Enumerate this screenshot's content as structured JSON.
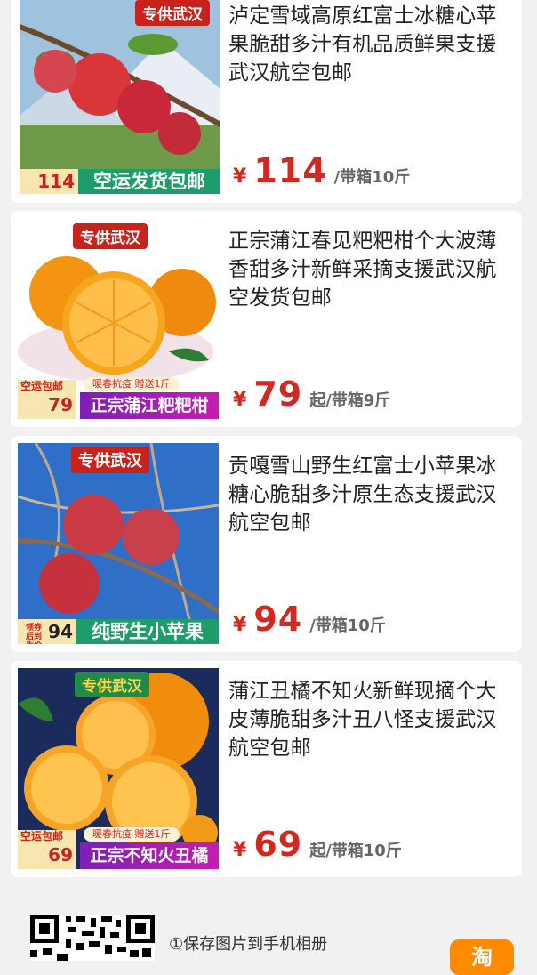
{
  "products": [
    {
      "title": "泸定雪域高原红富士冰糖心苹果脆甜多汁有机品质鲜果支援武汉航空包邮",
      "yen": "¥",
      "price": "114",
      "unit": "/带箱10斤",
      "thumb_tag": "专供武汉",
      "thumb_banner": "空运发货包邮",
      "thumb_price": "114"
    },
    {
      "title": "正宗蒲江春见粑粑柑个大波薄香甜多汁新鲜采摘支援武汉航空发货包邮",
      "yen": "¥",
      "price": "79",
      "unit": "起/带箱9斤",
      "thumb_tag": "专供武汉",
      "thumb_banner": "正宗蒲江粑粑柑",
      "thumb_badge_label": "空运包邮",
      "thumb_price": "79",
      "thumb_chip": "暖春抗疫  赠送1斤"
    },
    {
      "title": "贡嘎雪山野生红富士小苹果冰糖心脆甜多汁原生态支援武汉航空包邮",
      "yen": "¥",
      "price": "94",
      "unit": "/带箱10斤",
      "thumb_tag": "专供武汉",
      "thumb_banner": "纯野生小苹果",
      "thumb_badge_label": "领券后到手价",
      "thumb_price": "94"
    },
    {
      "title": "蒲江丑橘不知火新鲜现摘个大皮薄脆甜多汁丑八怪支援武汉航空包邮",
      "yen": "¥",
      "price": "69",
      "unit": "起/带箱10斤",
      "thumb_tag": "专供武汉",
      "thumb_banner": "正宗不知火丑橘",
      "thumb_badge_label": "空运包邮",
      "thumb_price": "69",
      "thumb_chip": "暖春抗疫  赠送1斤"
    }
  ],
  "footer": {
    "save_hint": "①保存图片到手机相册",
    "app_icon_text": "淘"
  },
  "colors": {
    "price_red": "#d4271f",
    "background": "#f1f1f1",
    "promo_purple": "#7d1fb5",
    "banner_green": "#1e9c6a"
  }
}
